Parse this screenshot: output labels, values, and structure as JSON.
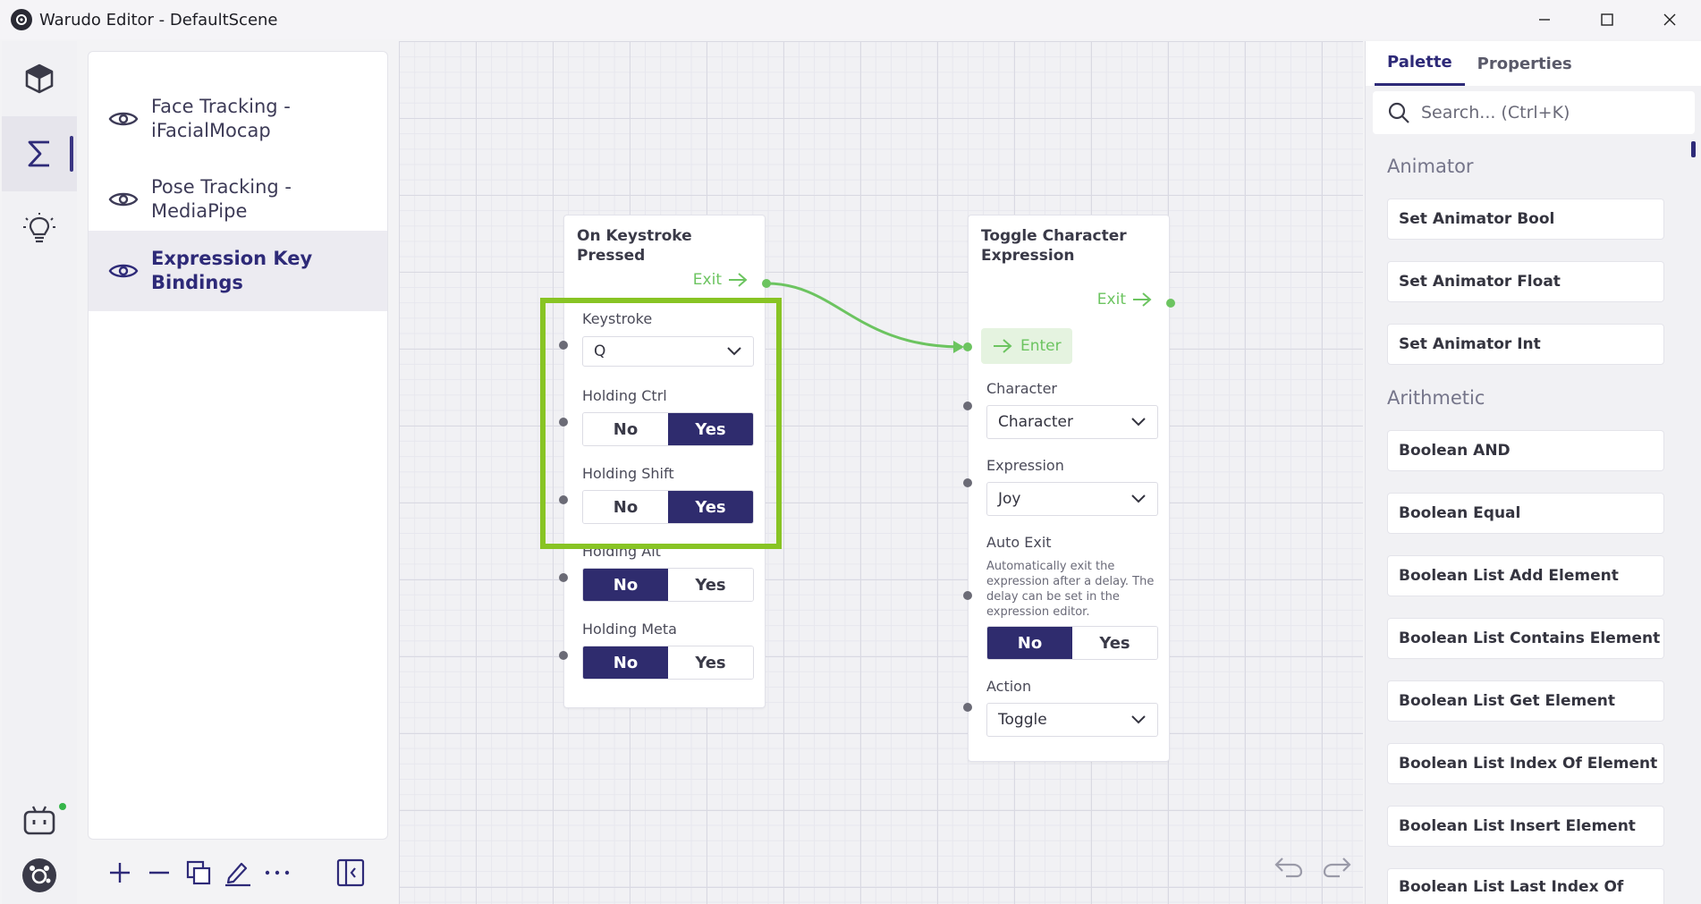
{
  "window": {
    "title": "Warudo Editor - DefaultScene"
  },
  "sidebar": {
    "items": [
      {
        "label_line1": "Face Tracking -",
        "label_line2": "iFacialMocap"
      },
      {
        "label_line1": "Pose Tracking -",
        "label_line2": "MediaPipe"
      },
      {
        "label_line1": "Expression Key",
        "label_line2": "Bindings",
        "selected": true
      }
    ]
  },
  "nodes": {
    "keystroke": {
      "title": "On Keystroke Pressed",
      "exit_label": "Exit",
      "keystroke_label": "Keystroke",
      "keystroke_value": "Q",
      "ctrl_label": "Holding Ctrl",
      "shift_label": "Holding Shift",
      "alt_label": "Holding Alt",
      "meta_label": "Holding Meta",
      "no": "No",
      "yes": "Yes",
      "ctrl_value": "Yes",
      "shift_value": "Yes",
      "alt_value": "No",
      "meta_value": "No"
    },
    "toggle": {
      "title_line1": "Toggle Character",
      "title_line2": "Expression",
      "exit_label": "Exit",
      "enter_label": "Enter",
      "character_label": "Character",
      "character_value": "Character",
      "expression_label": "Expression",
      "expression_value": "Joy",
      "auto_exit_label": "Auto Exit",
      "auto_exit_desc_1": "Automatically exit the",
      "auto_exit_desc_2": "expression after a delay. The",
      "auto_exit_desc_3": "delay can be set in the",
      "auto_exit_desc_4": "expression editor.",
      "auto_exit_value": "No",
      "action_label": "Action",
      "action_value": "Toggle",
      "no": "No",
      "yes": "Yes"
    }
  },
  "right_panel": {
    "tabs": [
      "Palette",
      "Properties"
    ],
    "active_tab": "Palette",
    "search_placeholder": "Search... (Ctrl+K)",
    "sections": [
      {
        "name": "Animator",
        "items": [
          "Set Animator Bool",
          "Set Animator Float",
          "Set Animator Int"
        ]
      },
      {
        "name": "Arithmetic",
        "items": [
          "Boolean AND",
          "Boolean Equal",
          "Boolean List Add Element",
          "Boolean List Contains Element",
          "Boolean List Get Element",
          "Boolean List Index Of Element",
          "Boolean List Insert Element",
          "Boolean List Last Index Of"
        ]
      }
    ]
  },
  "colors": {
    "accent": "#2e2a78",
    "flow_green": "#6cc460",
    "highlight": "#88c424",
    "status_online": "#35b549"
  }
}
